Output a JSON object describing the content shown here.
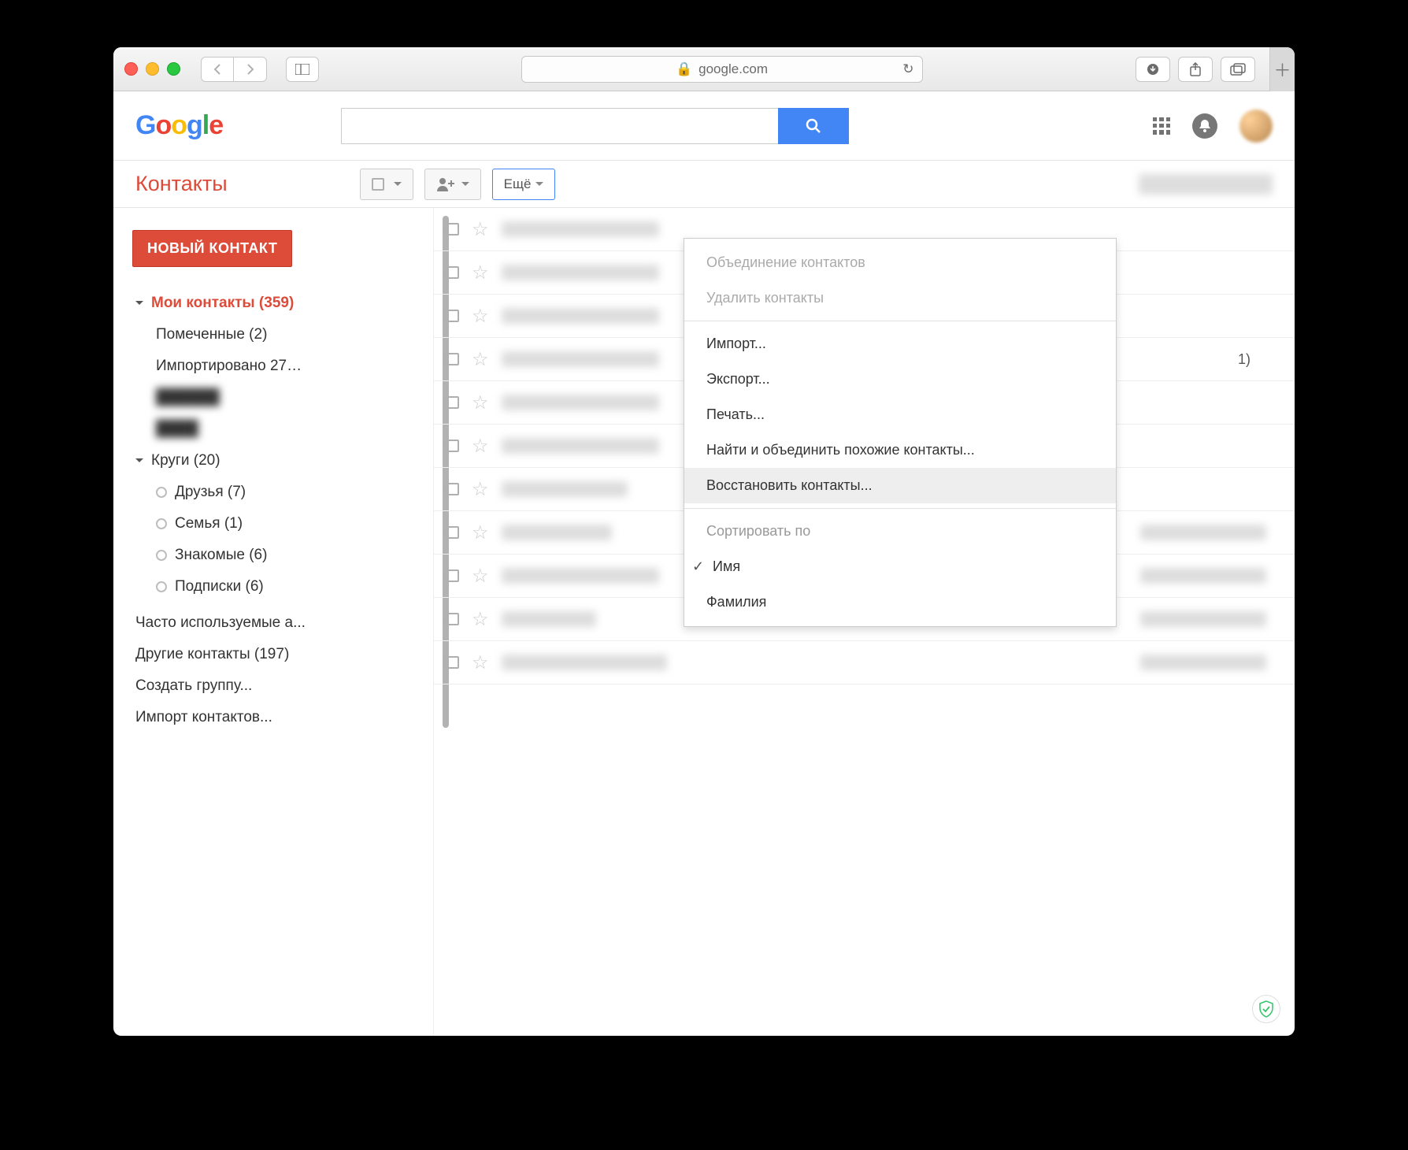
{
  "browser": {
    "url_host": "google.com"
  },
  "header": {
    "logo_letters": [
      "G",
      "o",
      "o",
      "g",
      "l",
      "e"
    ]
  },
  "page": {
    "title": "Контакты"
  },
  "toolbar": {
    "more_label": "Ещё"
  },
  "sidebar": {
    "new_button": "НОВЫЙ КОНТАКТ",
    "my_contacts": "Мои контакты (359)",
    "starred": "Помеченные (2)",
    "imported": "Импортировано 27…",
    "circles": "Круги (20)",
    "friends": "Друзья (7)",
    "family": "Семья (1)",
    "acquaint": "Знакомые (6)",
    "subs": "Подписки (6)",
    "frequent": "Часто используемые а...",
    "other": "Другие контакты (197)",
    "create_group": "Создать группу...",
    "import_contacts": "Импорт контактов..."
  },
  "list": {
    "row4_right": "1)"
  },
  "menu": {
    "merge": "Объединение контактов",
    "delete": "Удалить контакты",
    "import": "Импорт...",
    "export": "Экспорт...",
    "print": "Печать...",
    "find_merge": "Найти и объединить похожие контакты...",
    "restore": "Восстановить контакты...",
    "sort_by": "Сортировать по",
    "name": "Имя",
    "surname": "Фамилия"
  }
}
